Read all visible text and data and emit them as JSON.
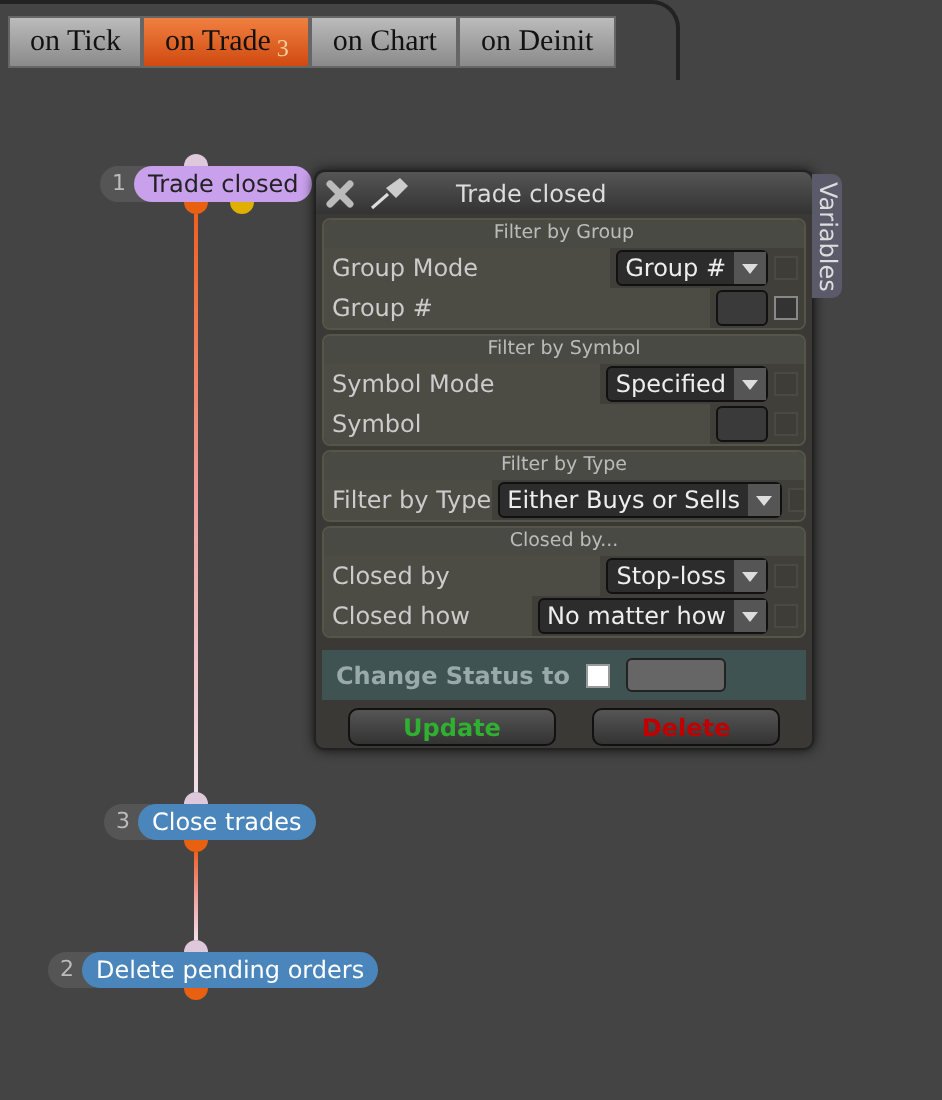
{
  "tabs": [
    {
      "label": "on Tick",
      "selected": false
    },
    {
      "label": "on Trade",
      "badge": "3",
      "selected": true
    },
    {
      "label": "on Chart",
      "selected": false
    },
    {
      "label": "on Deinit",
      "selected": false
    }
  ],
  "nodes": [
    {
      "number": "1",
      "label": "Trade closed",
      "kind": "event"
    },
    {
      "number": "3",
      "label": "Close trades",
      "kind": "action"
    },
    {
      "number": "2",
      "label": "Delete pending orders",
      "kind": "action"
    }
  ],
  "panel": {
    "title": "Trade closed",
    "side_tab": "Variables",
    "sections": [
      {
        "title": "Filter by Group",
        "rows": [
          {
            "label": "Group Mode",
            "kind": "select",
            "value": "Group #",
            "checkbox": {
              "checked": false,
              "disabled": true
            }
          },
          {
            "label": "Group #",
            "kind": "input",
            "checkbox": {
              "checked": false,
              "disabled": false
            }
          }
        ]
      },
      {
        "title": "Filter by Symbol",
        "rows": [
          {
            "label": "Symbol Mode",
            "kind": "select",
            "value": "Specified",
            "checkbox": {
              "checked": false,
              "disabled": true
            }
          },
          {
            "label": "Symbol",
            "kind": "input",
            "checkbox": {
              "checked": false,
              "disabled": true
            }
          }
        ]
      },
      {
        "title": "Filter by Type",
        "rows": [
          {
            "label": "Filter by Type",
            "kind": "select",
            "value": "Either Buys or Sells",
            "checkbox": {
              "checked": false,
              "disabled": true
            }
          }
        ]
      },
      {
        "title": "Closed by...",
        "rows": [
          {
            "label": "Closed by",
            "kind": "select",
            "value": "Stop-loss",
            "checkbox": {
              "checked": false,
              "disabled": true
            }
          },
          {
            "label": "Closed how",
            "kind": "select",
            "value": "No matter how",
            "checkbox": {
              "checked": false,
              "disabled": true
            }
          }
        ]
      }
    ],
    "change_status": {
      "label": "Change Status to",
      "checked": false
    },
    "buttons": [
      {
        "label": "Update",
        "kind": "update"
      },
      {
        "label": "Delete",
        "kind": "delete"
      }
    ]
  }
}
